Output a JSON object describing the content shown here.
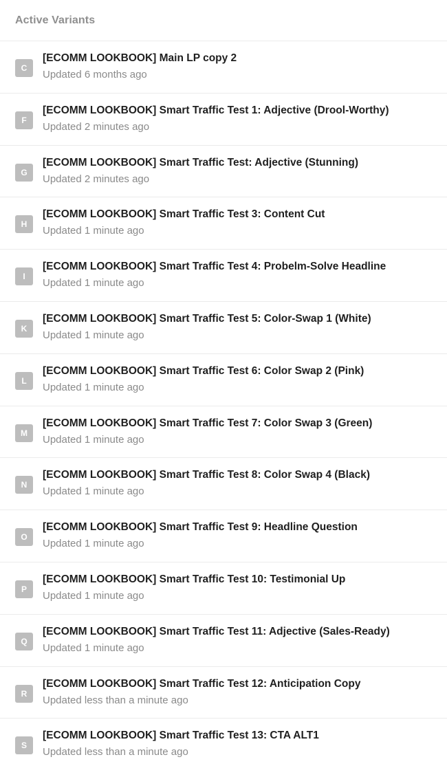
{
  "section": {
    "title": "Active Variants"
  },
  "variants": [
    {
      "letter": "C",
      "name": "[ECOMM LOOKBOOK] Main LP copy 2",
      "updated": "Updated 6 months ago"
    },
    {
      "letter": "F",
      "name": "[ECOMM LOOKBOOK] Smart Traffic Test 1: Adjective (Drool-Worthy)",
      "updated": "Updated 2 minutes ago"
    },
    {
      "letter": "G",
      "name": "[ECOMM LOOKBOOK] Smart Traffic Test: Adjective (Stunning)",
      "updated": "Updated 2 minutes ago"
    },
    {
      "letter": "H",
      "name": "[ECOMM LOOKBOOK] Smart Traffic Test 3: Content Cut",
      "updated": "Updated 1 minute ago"
    },
    {
      "letter": "I",
      "name": "[ECOMM LOOKBOOK] Smart Traffic Test 4: Probelm-Solve Headline",
      "updated": "Updated 1 minute ago"
    },
    {
      "letter": "K",
      "name": "[ECOMM LOOKBOOK] Smart Traffic Test 5: Color-Swap 1 (White)",
      "updated": "Updated 1 minute ago"
    },
    {
      "letter": "L",
      "name": "[ECOMM LOOKBOOK] Smart Traffic Test 6: Color Swap 2 (Pink)",
      "updated": "Updated 1 minute ago"
    },
    {
      "letter": "M",
      "name": "[ECOMM LOOKBOOK] Smart Traffic Test 7: Color Swap 3 (Green)",
      "updated": "Updated 1 minute ago"
    },
    {
      "letter": "N",
      "name": "[ECOMM LOOKBOOK] Smart Traffic Test 8: Color Swap 4 (Black)",
      "updated": "Updated 1 minute ago"
    },
    {
      "letter": "O",
      "name": "[ECOMM LOOKBOOK] Smart Traffic Test 9: Headline Question",
      "updated": "Updated 1 minute ago"
    },
    {
      "letter": "P",
      "name": "[ECOMM LOOKBOOK] Smart Traffic Test 10: Testimonial Up",
      "updated": "Updated 1 minute ago"
    },
    {
      "letter": "Q",
      "name": "[ECOMM LOOKBOOK] Smart Traffic Test 11: Adjective (Sales-Ready)",
      "updated": "Updated 1 minute ago"
    },
    {
      "letter": "R",
      "name": "[ECOMM LOOKBOOK] Smart Traffic Test 12: Anticipation Copy",
      "updated": "Updated less than a minute ago"
    },
    {
      "letter": "S",
      "name": "[ECOMM LOOKBOOK] Smart Traffic Test 13: CTA ALT1",
      "updated": "Updated less than a minute ago"
    }
  ],
  "colors": {
    "badge_background": "#bdbdbd",
    "header_text": "#8f8f8f",
    "divider": "#ebebeb"
  }
}
